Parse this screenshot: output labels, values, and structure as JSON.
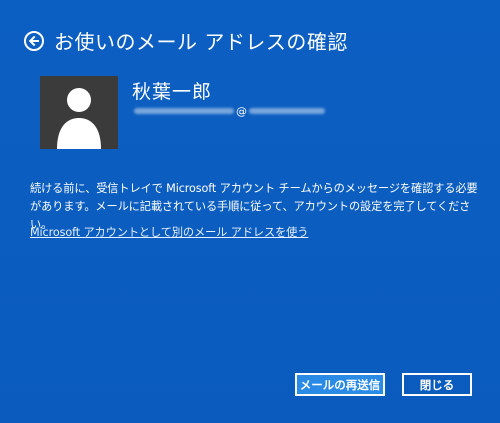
{
  "header": {
    "title": "お使いのメール アドレスの確認",
    "back_icon": "back-arrow-circle-icon"
  },
  "account": {
    "name": "秋葉一郎",
    "email_at": "@",
    "avatar_icon": "user-silhouette-icon"
  },
  "body": {
    "message": "続ける前に、受信トレイで Microsoft アカウント チームからのメッセージを確認する必要があります。メールに記載されている手順に従って、アカウントの設定を完了してください。",
    "alternate_link": "Microsoft アカウントとして別のメール アドレスを使う"
  },
  "buttons": {
    "resend_label": "メールの再送信",
    "close_label": "閉じる"
  },
  "colors": {
    "background": "#0a5bbd",
    "primary_button": "#2a8be6",
    "avatar_background": "#3b3b3b"
  }
}
